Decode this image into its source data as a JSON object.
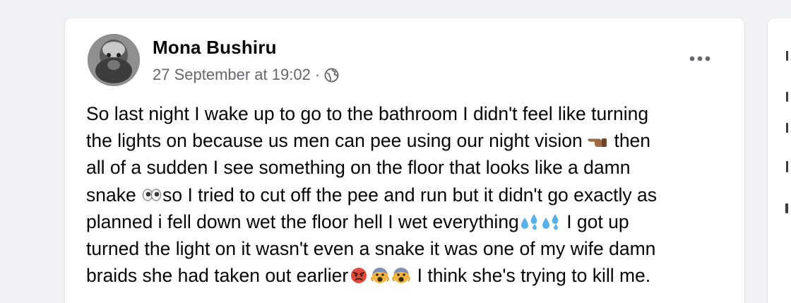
{
  "post": {
    "author": "Mona Bushiru",
    "timestamp": "27 September at 19:02",
    "separator": "·",
    "privacy_icon": "globe-icon",
    "more_icon": "more-options-icon",
    "lines": [
      "So last night I wake up to go to the bathroom I didn't feel like turning",
      "the lights on because us men can pee using our night vision",
      "then",
      "all of a sudden I see something on the floor that looks like a damn",
      "snake",
      "so I tried to cut off the pee and run but it didn't go exactly as",
      "planned i fell down wet the floor hell I wet everything",
      "I got up",
      "turned the light on it wasn't even a snake it was one of my wife damn",
      "braids she had taken out earlier",
      "I think she's trying to kill me."
    ],
    "emojis": {
      "point": "pointing-hand-emoji",
      "eyes": "eyes-emoji",
      "sweat": "sweat-droplets-emoji",
      "angry": "angry-face-emoji",
      "scream": "screaming-face-emoji"
    }
  },
  "colors": {
    "background": "#f0f2f5",
    "card": "#ffffff",
    "text_primary": "#050505",
    "text_secondary": "#65676b",
    "droplet_blue": "#5ab0e8",
    "angry_red": "#e0493b"
  }
}
